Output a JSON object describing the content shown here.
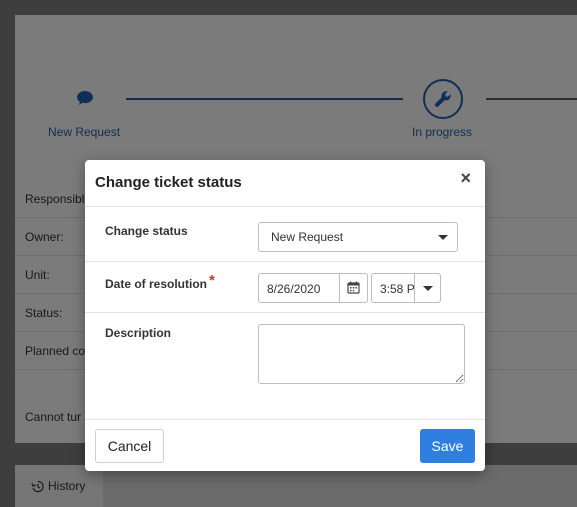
{
  "progress": {
    "steps": [
      {
        "label": "New Request",
        "icon": "chat-bubble-icon"
      },
      {
        "label": "In progress",
        "icon": "wrench-icon"
      }
    ]
  },
  "fields": {
    "responsible": "Responsible",
    "owner": "Owner:",
    "unit": "Unit:",
    "status": "Status:",
    "planned": "Planned co",
    "cannot": "Cannot tur"
  },
  "tabs": {
    "history": "History"
  },
  "modal": {
    "title": "Change ticket status",
    "close": "×",
    "change_status_label": "Change status",
    "change_status_value": "New Request",
    "date_label": "Date of resolution",
    "required_mark": "*",
    "date_value": "8/26/2020",
    "time_value": "3:58 P",
    "description_label": "Description",
    "description_value": "",
    "cancel_label": "Cancel",
    "save_label": "Save"
  },
  "colors": {
    "accent": "#1f5fa8",
    "primary_button": "#2f7fe0",
    "required": "#c0392b"
  }
}
